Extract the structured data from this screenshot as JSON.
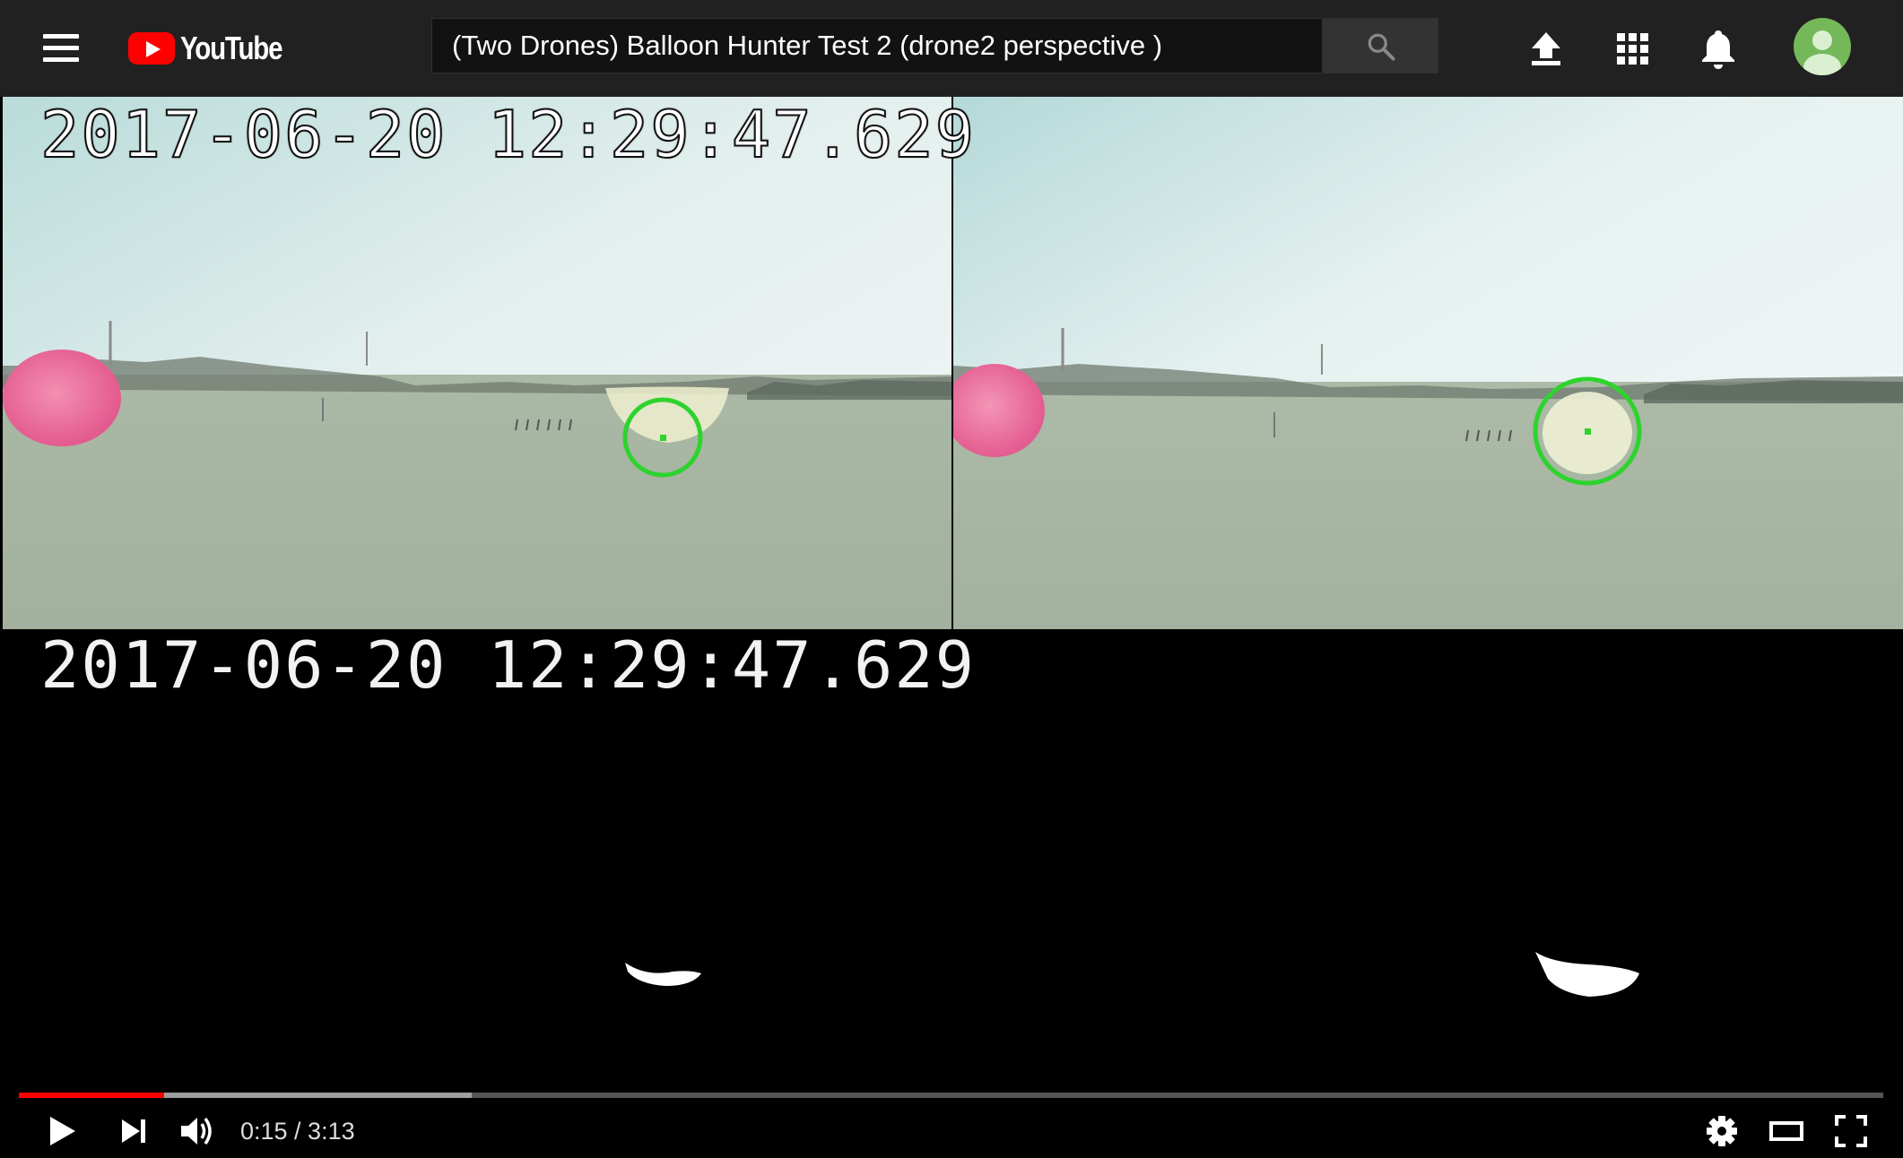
{
  "header": {
    "logo_text": "YouTube",
    "search_value": "(Two Drones) Balloon Hunter Test 2 (drone2 perspective )"
  },
  "icons": {
    "menu": "hamburger-menu-icon",
    "logo": "youtube-logo-icon",
    "search": "search-icon",
    "upload": "upload-icon",
    "apps": "apps-grid-icon",
    "notifications": "bell-icon",
    "avatar": "account-avatar-icon",
    "play": "play-icon",
    "next": "skip-next-icon",
    "volume": "volume-icon",
    "settings": "gear-icon",
    "theater": "theater-mode-icon",
    "fullscreen": "fullscreen-icon"
  },
  "video": {
    "timestamp_top": "2017-06-20 12:29:47.629",
    "timestamp_bottom": "2017-06-20 12:29:47.629"
  },
  "player": {
    "current_time": "0:15",
    "duration": "3:13",
    "time_display": "0:15 / 3:13",
    "played_fraction": 0.0777,
    "buffered_fraction": 0.2428
  },
  "colors": {
    "brand_red": "#ff0000",
    "topbar_bg": "#212121",
    "detection_ring": "#2ed32e",
    "balloon_pink": "#e8558f"
  }
}
